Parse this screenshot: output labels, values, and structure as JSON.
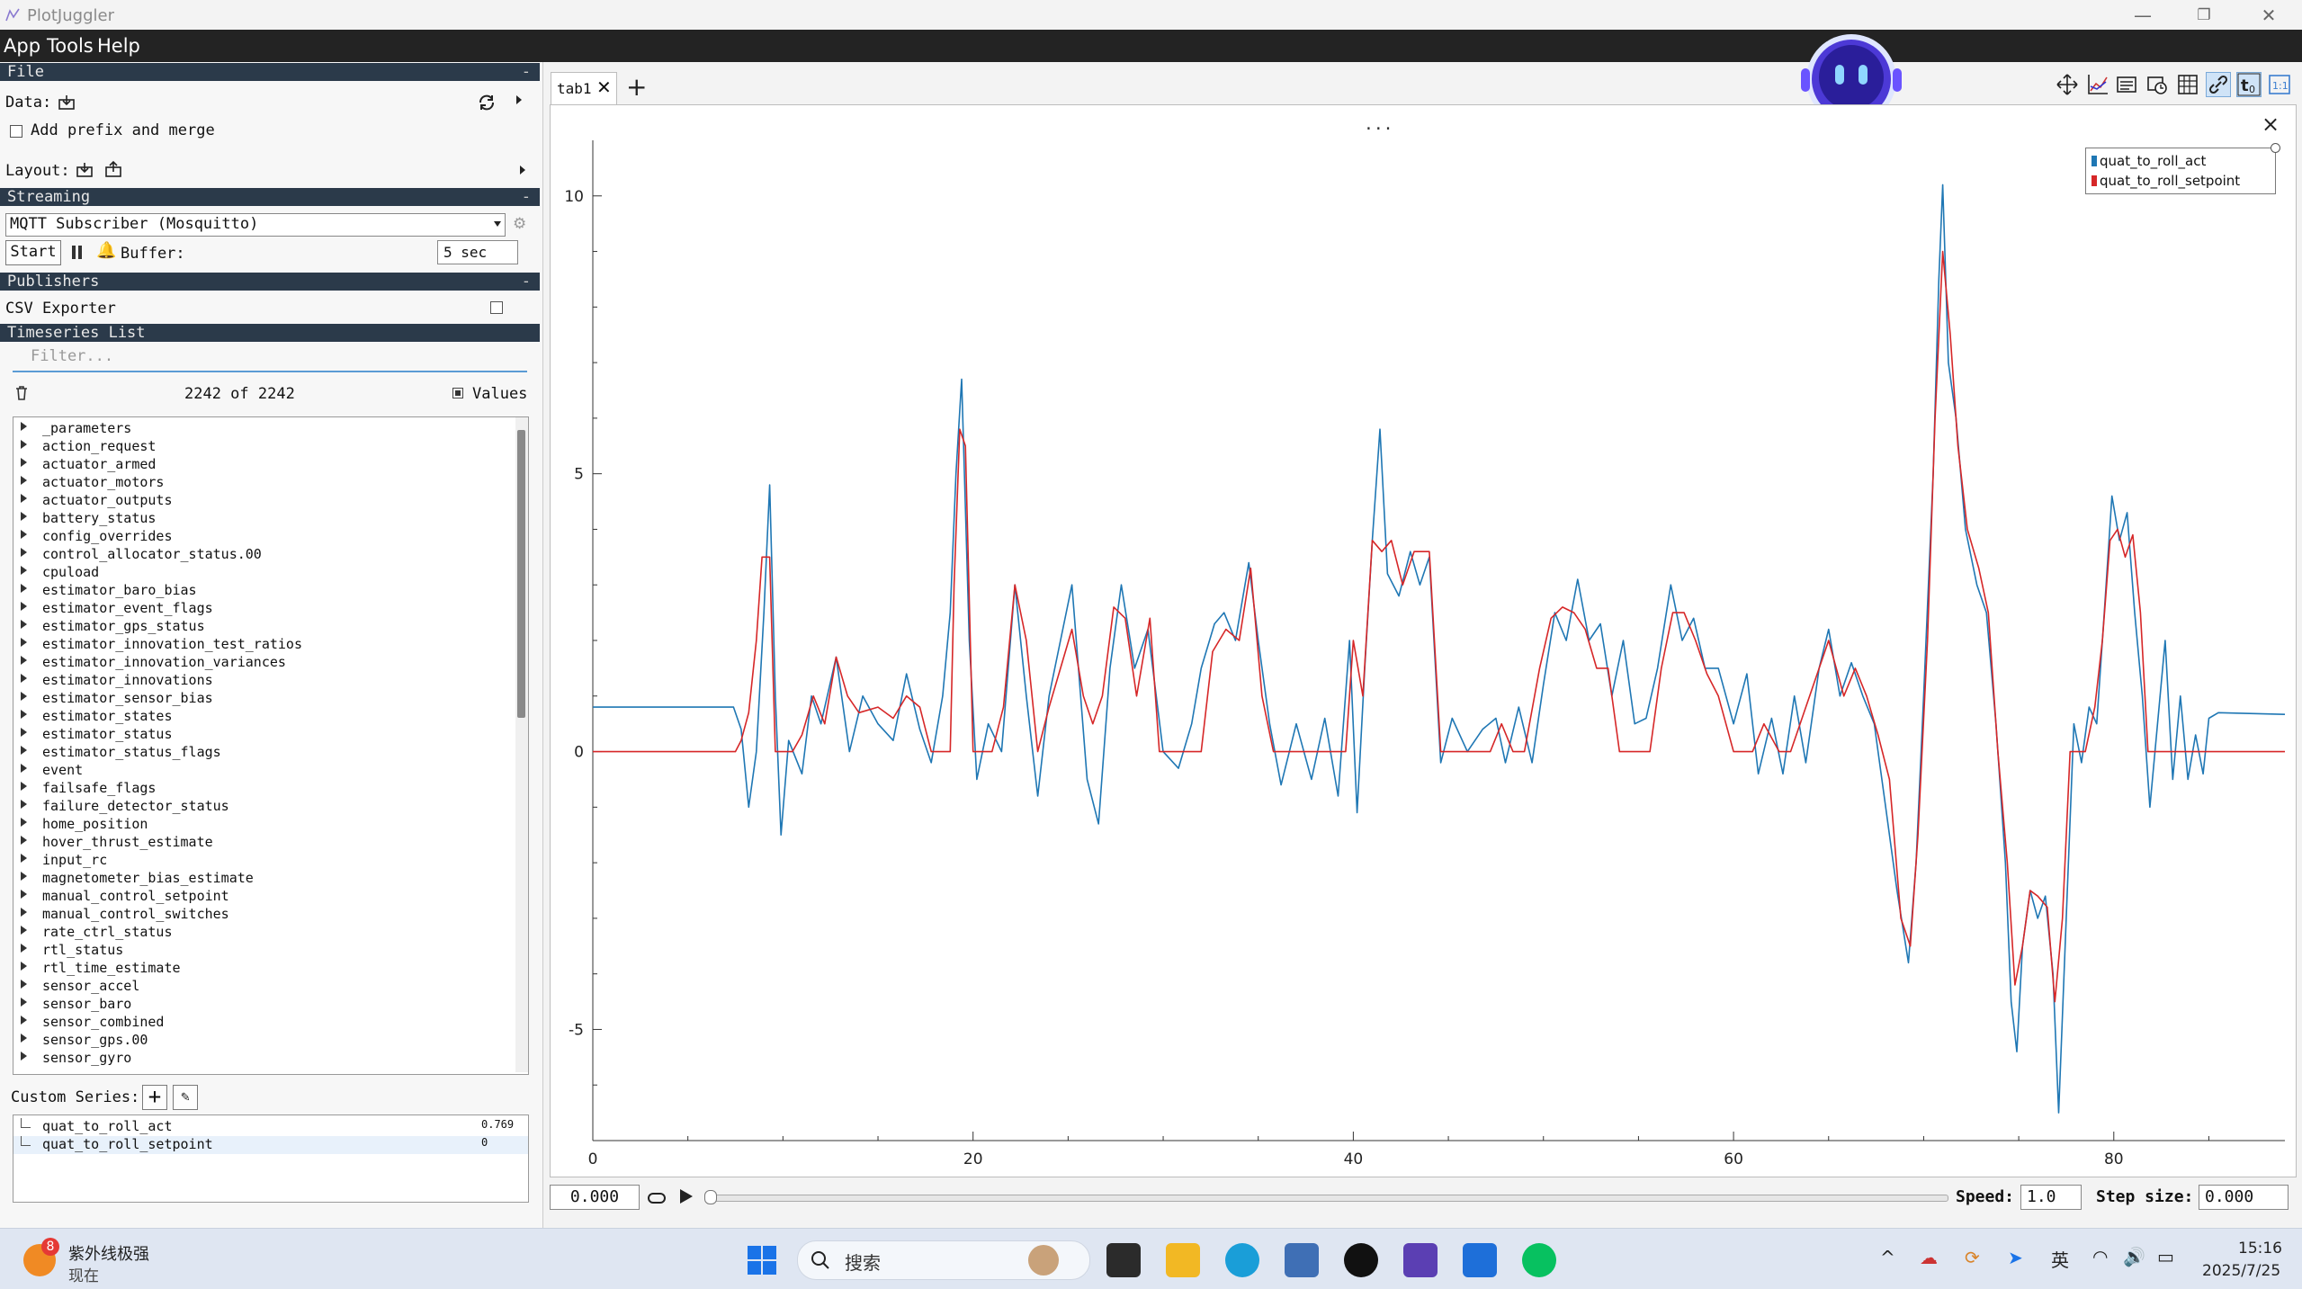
{
  "window": {
    "title": "PlotJuggler",
    "controls": {
      "minimize": "—",
      "restore": "❐",
      "close": "✕"
    }
  },
  "menu": [
    "App",
    "Tools",
    "Help"
  ],
  "sections": {
    "file": "File",
    "streaming": "Streaming",
    "publishers": "Publishers",
    "timeseries": "Timeseries List"
  },
  "file": {
    "data_label": "Data:",
    "add_prefix_label": "Add prefix and merge",
    "layout_label": "Layout:"
  },
  "streaming": {
    "source": "MQTT Subscriber (Mosquitto)",
    "start_label": "Start",
    "buffer_label": "Buffer:",
    "buffer_value": "5 sec"
  },
  "publishers": {
    "csv_exporter": "CSV Exporter"
  },
  "timeseries": {
    "filter_placeholder": "Filter...",
    "count": "2242 of 2242",
    "values_label": "Values",
    "items": [
      "_parameters",
      "action_request",
      "actuator_armed",
      "actuator_motors",
      "actuator_outputs",
      "battery_status",
      "config_overrides",
      "control_allocator_status.00",
      "cpuload",
      "estimator_baro_bias",
      "estimator_event_flags",
      "estimator_gps_status",
      "estimator_innovation_test_ratios",
      "estimator_innovation_variances",
      "estimator_innovations",
      "estimator_sensor_bias",
      "estimator_states",
      "estimator_status",
      "estimator_status_flags",
      "event",
      "failsafe_flags",
      "failure_detector_status",
      "home_position",
      "hover_thrust_estimate",
      "input_rc",
      "magnetometer_bias_estimate",
      "manual_control_setpoint",
      "manual_control_switches",
      "rate_ctrl_status",
      "rtl_status",
      "rtl_time_estimate",
      "sensor_accel",
      "sensor_baro",
      "sensor_combined",
      "sensor_gps.00",
      "sensor_gyro"
    ]
  },
  "custom_series": {
    "label": "Custom Series:",
    "items": [
      {
        "name": "quat_to_roll_act",
        "value": "0.769"
      },
      {
        "name": "quat_to_roll_setpoint",
        "value": "0"
      }
    ]
  },
  "tabs": [
    {
      "label": "tab1"
    }
  ],
  "plot": {
    "dots": "...",
    "close": "×"
  },
  "controls": {
    "time_value": "0.000",
    "speed_label": "Speed:",
    "speed_value": "1.0",
    "step_label": "Step size:",
    "step_value": "0.000"
  },
  "chart_data": {
    "type": "line",
    "xlim": [
      0,
      89
    ],
    "ylim": [
      -7,
      11
    ],
    "x_ticks": [
      0,
      20,
      40,
      60,
      80
    ],
    "y_ticks": [
      10,
      5,
      0,
      -5
    ],
    "legend_position": "top-right",
    "series": [
      {
        "name": "quat_to_roll_act",
        "color": "#1f77b4",
        "points": [
          [
            0,
            0.8
          ],
          [
            7.4,
            0.8
          ],
          [
            7.8,
            0.4
          ],
          [
            8.2,
            -1.0
          ],
          [
            8.6,
            0.0
          ],
          [
            9.0,
            2.5
          ],
          [
            9.3,
            4.8
          ],
          [
            9.6,
            1.0
          ],
          [
            9.9,
            -1.5
          ],
          [
            10.3,
            0.2
          ],
          [
            11.0,
            -0.4
          ],
          [
            11.5,
            1.0
          ],
          [
            12.0,
            0.5
          ],
          [
            12.8,
            1.7
          ],
          [
            13.5,
            0.0
          ],
          [
            14.2,
            1.0
          ],
          [
            15.0,
            0.5
          ],
          [
            15.8,
            0.2
          ],
          [
            16.5,
            1.4
          ],
          [
            17.2,
            0.4
          ],
          [
            17.8,
            -0.2
          ],
          [
            18.4,
            1.0
          ],
          [
            18.8,
            2.5
          ],
          [
            19.1,
            5.0
          ],
          [
            19.4,
            6.7
          ],
          [
            19.8,
            2.0
          ],
          [
            20.2,
            -0.5
          ],
          [
            20.8,
            0.5
          ],
          [
            21.5,
            0.0
          ],
          [
            22.2,
            3.0
          ],
          [
            22.8,
            1.0
          ],
          [
            23.4,
            -0.8
          ],
          [
            24.0,
            1.0
          ],
          [
            24.6,
            2.0
          ],
          [
            25.2,
            3.0
          ],
          [
            26.0,
            -0.5
          ],
          [
            26.6,
            -1.3
          ],
          [
            27.2,
            1.5
          ],
          [
            27.8,
            3.0
          ],
          [
            28.5,
            1.5
          ],
          [
            29.2,
            2.2
          ],
          [
            30.0,
            0.0
          ],
          [
            30.8,
            -0.3
          ],
          [
            31.5,
            0.5
          ],
          [
            32.0,
            1.5
          ],
          [
            32.7,
            2.3
          ],
          [
            33.2,
            2.5
          ],
          [
            33.8,
            2.0
          ],
          [
            34.5,
            3.4
          ],
          [
            35.0,
            2.0
          ],
          [
            35.6,
            0.5
          ],
          [
            36.2,
            -0.6
          ],
          [
            37.0,
            0.5
          ],
          [
            37.8,
            -0.5
          ],
          [
            38.5,
            0.6
          ],
          [
            39.2,
            -0.8
          ],
          [
            39.8,
            2.0
          ],
          [
            40.2,
            -1.1
          ],
          [
            40.6,
            1.5
          ],
          [
            41.0,
            3.8
          ],
          [
            41.4,
            5.8
          ],
          [
            41.8,
            3.2
          ],
          [
            42.4,
            2.8
          ],
          [
            43.0,
            3.6
          ],
          [
            43.5,
            3.0
          ],
          [
            44.0,
            3.5
          ],
          [
            44.6,
            -0.2
          ],
          [
            45.2,
            0.6
          ],
          [
            46.0,
            0.0
          ],
          [
            46.8,
            0.4
          ],
          [
            47.5,
            0.6
          ],
          [
            48.0,
            -0.2
          ],
          [
            48.7,
            0.8
          ],
          [
            49.4,
            -0.2
          ],
          [
            50.0,
            1.2
          ],
          [
            50.6,
            2.5
          ],
          [
            51.2,
            2.0
          ],
          [
            51.8,
            3.1
          ],
          [
            52.4,
            2.0
          ],
          [
            53.0,
            2.3
          ],
          [
            53.6,
            1.0
          ],
          [
            54.2,
            2.0
          ],
          [
            54.8,
            0.5
          ],
          [
            55.4,
            0.6
          ],
          [
            56.0,
            1.5
          ],
          [
            56.7,
            3.0
          ],
          [
            57.3,
            2.0
          ],
          [
            57.9,
            2.4
          ],
          [
            58.5,
            1.5
          ],
          [
            59.2,
            1.5
          ],
          [
            60.0,
            0.5
          ],
          [
            60.7,
            1.4
          ],
          [
            61.3,
            -0.4
          ],
          [
            62.0,
            0.6
          ],
          [
            62.6,
            -0.4
          ],
          [
            63.2,
            1.0
          ],
          [
            63.8,
            -0.2
          ],
          [
            64.5,
            1.5
          ],
          [
            65.0,
            2.2
          ],
          [
            65.6,
            1.0
          ],
          [
            66.2,
            1.6
          ],
          [
            66.8,
            1.0
          ],
          [
            67.4,
            0.5
          ],
          [
            68.0,
            -1.0
          ],
          [
            68.6,
            -2.5
          ],
          [
            69.2,
            -3.8
          ],
          [
            69.6,
            -2.0
          ],
          [
            70.0,
            1.0
          ],
          [
            70.5,
            5.0
          ],
          [
            70.8,
            8.5
          ],
          [
            71.0,
            10.2
          ],
          [
            71.3,
            7.0
          ],
          [
            71.7,
            6.0
          ],
          [
            72.2,
            4.0
          ],
          [
            72.8,
            3.0
          ],
          [
            73.3,
            2.5
          ],
          [
            73.8,
            0.5
          ],
          [
            74.3,
            -2.0
          ],
          [
            74.6,
            -4.5
          ],
          [
            74.9,
            -5.4
          ],
          [
            75.2,
            -3.5
          ],
          [
            75.6,
            -2.5
          ],
          [
            76.0,
            -3.0
          ],
          [
            76.4,
            -2.6
          ],
          [
            76.8,
            -4.0
          ],
          [
            77.1,
            -6.5
          ],
          [
            77.5,
            -3.0
          ],
          [
            77.9,
            0.5
          ],
          [
            78.3,
            -0.2
          ],
          [
            78.7,
            0.8
          ],
          [
            79.1,
            0.5
          ],
          [
            79.5,
            2.5
          ],
          [
            79.9,
            4.6
          ],
          [
            80.3,
            3.8
          ],
          [
            80.7,
            4.3
          ],
          [
            81.1,
            2.5
          ],
          [
            81.5,
            1.0
          ],
          [
            81.9,
            -1.0
          ],
          [
            82.3,
            0.5
          ],
          [
            82.7,
            2.0
          ],
          [
            83.1,
            -0.5
          ],
          [
            83.5,
            1.0
          ],
          [
            83.9,
            -0.5
          ],
          [
            84.3,
            0.3
          ],
          [
            84.7,
            -0.4
          ],
          [
            85.0,
            0.6
          ],
          [
            85.5,
            0.7
          ],
          [
            89,
            0.67
          ]
        ]
      },
      {
        "name": "quat_to_roll_setpoint",
        "color": "#d62728",
        "points": [
          [
            0,
            0
          ],
          [
            7.5,
            0
          ],
          [
            7.8,
            0.2
          ],
          [
            8.2,
            0.7
          ],
          [
            8.6,
            2.0
          ],
          [
            8.9,
            3.5
          ],
          [
            9.3,
            3.5
          ],
          [
            9.6,
            0
          ],
          [
            10.5,
            0
          ],
          [
            11.0,
            0.3
          ],
          [
            11.6,
            1.0
          ],
          [
            12.2,
            0.5
          ],
          [
            12.8,
            1.7
          ],
          [
            13.4,
            1.0
          ],
          [
            14.0,
            0.7
          ],
          [
            15.0,
            0.8
          ],
          [
            15.8,
            0.6
          ],
          [
            16.5,
            1.0
          ],
          [
            17.2,
            0.8
          ],
          [
            17.8,
            0
          ],
          [
            18.8,
            0
          ],
          [
            19.0,
            3.0
          ],
          [
            19.3,
            5.8
          ],
          [
            19.6,
            5.5
          ],
          [
            20.0,
            0
          ],
          [
            21.0,
            0
          ],
          [
            21.6,
            0.8
          ],
          [
            22.2,
            3.0
          ],
          [
            22.8,
            2.0
          ],
          [
            23.4,
            0
          ],
          [
            24.0,
            0.8
          ],
          [
            24.6,
            1.5
          ],
          [
            25.2,
            2.2
          ],
          [
            25.8,
            1.0
          ],
          [
            26.3,
            0.5
          ],
          [
            26.8,
            1.0
          ],
          [
            27.4,
            2.6
          ],
          [
            28.0,
            2.4
          ],
          [
            28.6,
            1.0
          ],
          [
            29.3,
            2.4
          ],
          [
            29.8,
            0
          ],
          [
            32.0,
            0
          ],
          [
            32.6,
            1.8
          ],
          [
            33.3,
            2.2
          ],
          [
            34.0,
            2.0
          ],
          [
            34.6,
            3.3
          ],
          [
            35.2,
            1.0
          ],
          [
            35.8,
            0
          ],
          [
            39.6,
            0
          ],
          [
            40.0,
            2.0
          ],
          [
            40.5,
            1.0
          ],
          [
            41.0,
            3.8
          ],
          [
            41.5,
            3.6
          ],
          [
            42.0,
            3.8
          ],
          [
            42.6,
            3.0
          ],
          [
            43.2,
            3.6
          ],
          [
            44.0,
            3.6
          ],
          [
            44.6,
            0
          ],
          [
            47.2,
            0
          ],
          [
            47.8,
            0.5
          ],
          [
            48.4,
            0
          ],
          [
            49.0,
            0
          ],
          [
            49.8,
            1.5
          ],
          [
            50.4,
            2.4
          ],
          [
            51.0,
            2.6
          ],
          [
            51.6,
            2.5
          ],
          [
            52.2,
            2.2
          ],
          [
            52.8,
            1.5
          ],
          [
            53.4,
            1.5
          ],
          [
            54.0,
            0
          ],
          [
            55.6,
            0
          ],
          [
            56.2,
            1.5
          ],
          [
            56.8,
            2.5
          ],
          [
            57.4,
            2.5
          ],
          [
            58.0,
            2.0
          ],
          [
            58.6,
            1.4
          ],
          [
            59.2,
            1.0
          ],
          [
            60.0,
            0
          ],
          [
            61.0,
            0
          ],
          [
            61.6,
            0.5
          ],
          [
            62.4,
            0
          ],
          [
            63.0,
            0
          ],
          [
            63.6,
            0.6
          ],
          [
            64.4,
            1.4
          ],
          [
            65.0,
            2.0
          ],
          [
            65.8,
            1.0
          ],
          [
            66.4,
            1.5
          ],
          [
            67.0,
            1.0
          ],
          [
            67.6,
            0.3
          ],
          [
            68.2,
            -0.5
          ],
          [
            68.8,
            -3.0
          ],
          [
            69.3,
            -3.5
          ],
          [
            69.7,
            -1.5
          ],
          [
            70.2,
            2.0
          ],
          [
            70.6,
            6.0
          ],
          [
            71.0,
            9.0
          ],
          [
            71.4,
            7.5
          ],
          [
            71.8,
            5.5
          ],
          [
            72.3,
            4.0
          ],
          [
            72.9,
            3.3
          ],
          [
            73.4,
            2.5
          ],
          [
            73.9,
            0
          ],
          [
            74.4,
            -2.0
          ],
          [
            74.8,
            -4.2
          ],
          [
            75.2,
            -3.5
          ],
          [
            75.6,
            -2.5
          ],
          [
            76.0,
            -2.6
          ],
          [
            76.5,
            -2.8
          ],
          [
            76.9,
            -4.5
          ],
          [
            77.3,
            -3.0
          ],
          [
            77.7,
            0
          ],
          [
            78.5,
            0
          ],
          [
            79.0,
            0.8
          ],
          [
            79.4,
            2.0
          ],
          [
            79.8,
            3.8
          ],
          [
            80.2,
            4.0
          ],
          [
            80.6,
            3.5
          ],
          [
            81.0,
            3.9
          ],
          [
            81.4,
            2.5
          ],
          [
            81.8,
            0
          ],
          [
            89,
            0
          ]
        ]
      }
    ]
  },
  "taskbar": {
    "weather_badge": "8",
    "weather_title": "紫外线极强",
    "weather_sub": "现在",
    "search_label": "搜索",
    "ime": "英",
    "time": "15:16",
    "date": "2025/7/25",
    "colors": {
      "start": "#1a73e8",
      "folder": "#f2b824",
      "edge": "#1a9ed8",
      "wechat": "#07c160"
    }
  }
}
